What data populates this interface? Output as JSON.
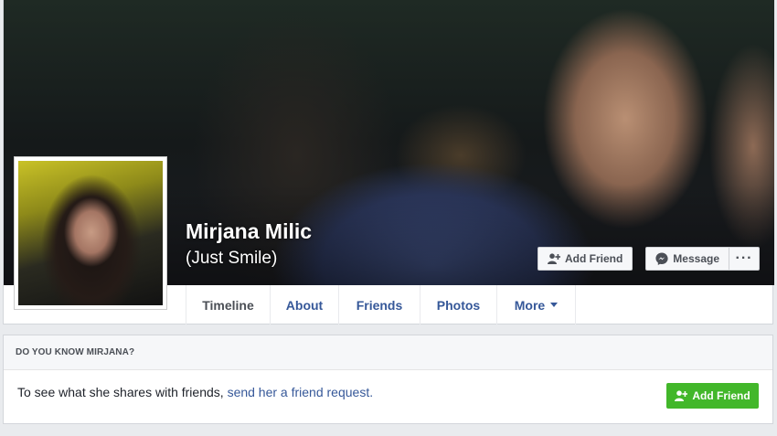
{
  "profile": {
    "name": "Mirjana Milic",
    "alternate_name": "(Just Smile)"
  },
  "actions": {
    "add_friend_label": "Add Friend",
    "message_label": "Message",
    "more_label": "···"
  },
  "tabs": [
    {
      "label": "Timeline",
      "active": true
    },
    {
      "label": "About"
    },
    {
      "label": "Friends"
    },
    {
      "label": "Photos"
    },
    {
      "label": "More"
    }
  ],
  "know_box": {
    "title": "DO YOU KNOW MIRJANA?",
    "text": "To see what she shares with friends, ",
    "link": "send her a friend request.",
    "button_label": "Add Friend"
  },
  "colors": {
    "link": "#365899",
    "green_button": "#42b72a",
    "page_background": "#e9ebee"
  },
  "icons": {
    "add_friend": "add-friend-icon",
    "message": "messenger-icon",
    "more_caret": "caret-down-icon"
  }
}
